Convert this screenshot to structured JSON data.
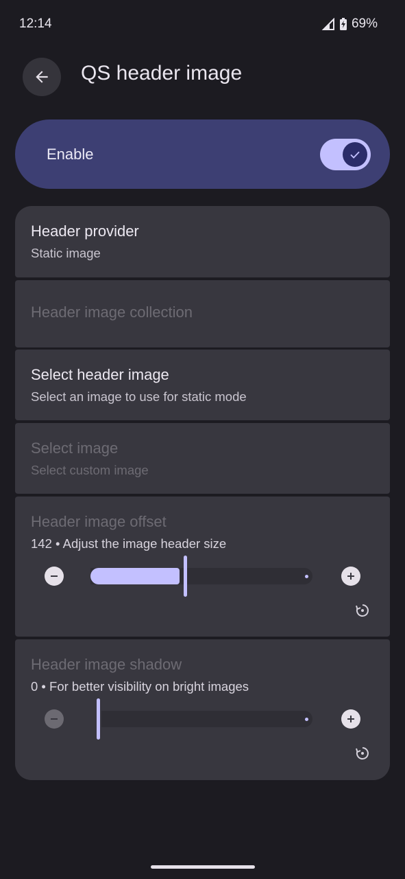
{
  "status_bar": {
    "time": "12:14",
    "battery": "69%",
    "icons": [
      "signal-icon",
      "battery-charging-icon"
    ]
  },
  "app_bar": {
    "title": "QS header image",
    "back_icon": "arrow-back-icon"
  },
  "enable": {
    "label": "Enable",
    "checked": true
  },
  "items": [
    {
      "title": "Header provider",
      "subtitle": "Static image",
      "enabled": true
    },
    {
      "title": "Header image collection",
      "subtitle": "",
      "enabled": false
    },
    {
      "title": "Select header image",
      "subtitle": "Select an image to use for static mode",
      "enabled": true
    },
    {
      "title": "Select image",
      "subtitle": "Select custom image",
      "enabled": false
    }
  ],
  "sliders": [
    {
      "title": "Header image offset",
      "summary": "142 • Adjust the image header size",
      "value": 142,
      "fill_fraction": 0.42,
      "enabled_title": false
    },
    {
      "title": "Header image shadow",
      "summary": "0 • For better visibility on bright images",
      "value": 0,
      "fill_fraction": 0.0,
      "enabled_title": false
    }
  ],
  "colors": {
    "background": "#1c1b21",
    "card": "#38373f",
    "accent": "#c3c0ff",
    "enable_card": "#3d3f73"
  }
}
